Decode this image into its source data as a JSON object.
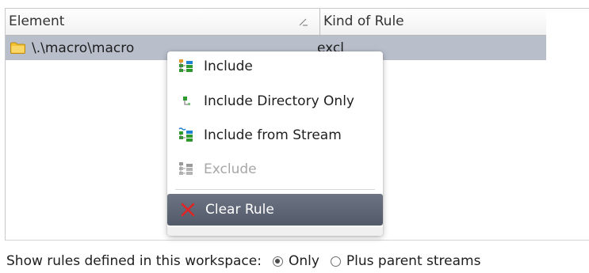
{
  "table": {
    "columns": [
      "Element",
      "Kind of Rule"
    ],
    "rows": [
      {
        "element": "\\.\\macro\\macro",
        "kind": "excl",
        "icon": "folder-icon"
      }
    ]
  },
  "context_menu": {
    "items": [
      {
        "label": "Include",
        "icon": "include-icon",
        "enabled": true
      },
      {
        "label": "Include Directory Only",
        "icon": "include-directory-icon",
        "enabled": true
      },
      {
        "label": "Include from Stream",
        "icon": "include-from-stream-icon",
        "enabled": true
      },
      {
        "label": "Exclude",
        "icon": "exclude-icon",
        "enabled": false
      },
      {
        "label": "Clear Rule",
        "icon": "clear-rule-icon",
        "enabled": true,
        "highlighted": true
      }
    ]
  },
  "footer": {
    "label": "Show rules defined in this workspace:",
    "options": [
      {
        "label": "Only",
        "selected": true
      },
      {
        "label": "Plus parent streams",
        "selected": false
      }
    ]
  },
  "colors": {
    "selected_row": "#b8bfcb",
    "menu_highlight": "#5e6676",
    "icon_green": "#2e9a2e",
    "icon_red": "#d62020"
  }
}
